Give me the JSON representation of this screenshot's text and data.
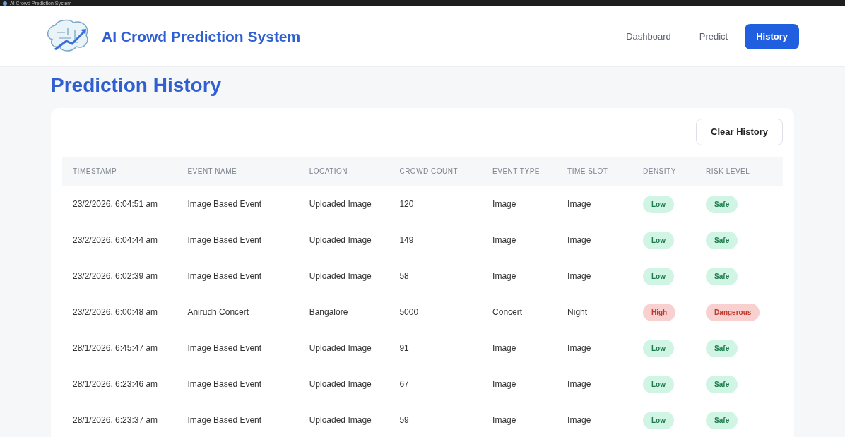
{
  "window": {
    "title": "AI Crowd Prediction System"
  },
  "brand": {
    "name": "AI Crowd Prediction System"
  },
  "nav": [
    {
      "label": "Dashboard",
      "selected": false
    },
    {
      "label": "Predict",
      "selected": false
    },
    {
      "label": "History",
      "selected": true
    }
  ],
  "page_title": "Prediction History",
  "clear_button": "Clear History",
  "table": {
    "columns": [
      "TIMESTAMP",
      "EVENT NAME",
      "LOCATION",
      "CROWD COUNT",
      "EVENT TYPE",
      "TIME SLOT",
      "DENSITY",
      "RISK LEVEL"
    ],
    "rows": [
      {
        "timestamp": "23/2/2026, 6:04:51 am",
        "event_name": "Image Based Event",
        "location": "Uploaded Image",
        "crowd_count": "120",
        "event_type": "Image",
        "time_slot": "Image",
        "density": {
          "text": "Low",
          "kind": "good"
        },
        "risk": {
          "text": "Safe",
          "kind": "good"
        }
      },
      {
        "timestamp": "23/2/2026, 6:04:44 am",
        "event_name": "Image Based Event",
        "location": "Uploaded Image",
        "crowd_count": "149",
        "event_type": "Image",
        "time_slot": "Image",
        "density": {
          "text": "Low",
          "kind": "good"
        },
        "risk": {
          "text": "Safe",
          "kind": "good"
        }
      },
      {
        "timestamp": "23/2/2026, 6:02:39 am",
        "event_name": "Image Based Event",
        "location": "Uploaded Image",
        "crowd_count": "58",
        "event_type": "Image",
        "time_slot": "Image",
        "density": {
          "text": "Low",
          "kind": "good"
        },
        "risk": {
          "text": "Safe",
          "kind": "good"
        }
      },
      {
        "timestamp": "23/2/2026, 6:00:48 am",
        "event_name": "Anirudh Concert",
        "location": "Bangalore",
        "crowd_count": "5000",
        "event_type": "Concert",
        "time_slot": "Night",
        "density": {
          "text": "High",
          "kind": "bad"
        },
        "risk": {
          "text": "Dangerous",
          "kind": "bad"
        }
      },
      {
        "timestamp": "28/1/2026, 6:45:47 am",
        "event_name": "Image Based Event",
        "location": "Uploaded Image",
        "crowd_count": "91",
        "event_type": "Image",
        "time_slot": "Image",
        "density": {
          "text": "Low",
          "kind": "good"
        },
        "risk": {
          "text": "Safe",
          "kind": "good"
        }
      },
      {
        "timestamp": "28/1/2026, 6:23:46 am",
        "event_name": "Image Based Event",
        "location": "Uploaded Image",
        "crowd_count": "67",
        "event_type": "Image",
        "time_slot": "Image",
        "density": {
          "text": "Low",
          "kind": "good"
        },
        "risk": {
          "text": "Safe",
          "kind": "good"
        }
      },
      {
        "timestamp": "28/1/2026, 6:23:37 am",
        "event_name": "Image Based Event",
        "location": "Uploaded Image",
        "crowd_count": "59",
        "event_type": "Image",
        "time_slot": "Image",
        "density": {
          "text": "Low",
          "kind": "good"
        },
        "risk": {
          "text": "Safe",
          "kind": "good"
        }
      }
    ]
  }
}
